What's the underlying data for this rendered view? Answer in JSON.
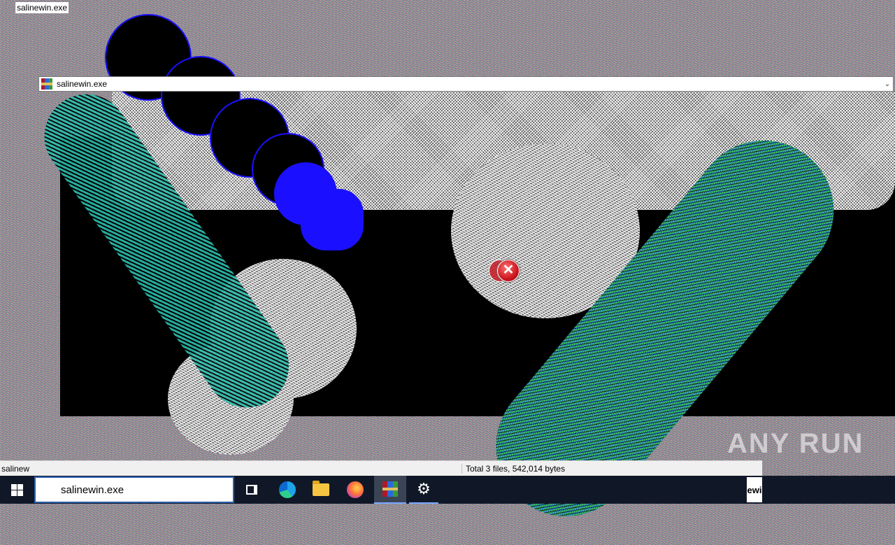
{
  "window": {
    "top_title": "salinewin.exe",
    "address": "salinewin.exe"
  },
  "status_bar": {
    "left": "salinew",
    "right": "Total 3 files, 542,014 bytes"
  },
  "watermark": "ANY RUN",
  "taskbar": {
    "search_value": "salinewin.exe",
    "apps": [
      "task-view",
      "edge",
      "file-explorer",
      "firefox",
      "winrar",
      "settings"
    ],
    "tray_fragment": "ewi"
  },
  "colors": {
    "taskbar": "#101828",
    "error_red": "#c8101a",
    "glitch_blue": "#1a10ff",
    "glitch_cyan": "#2bbfae",
    "glitch_green": "#3dbf55"
  }
}
